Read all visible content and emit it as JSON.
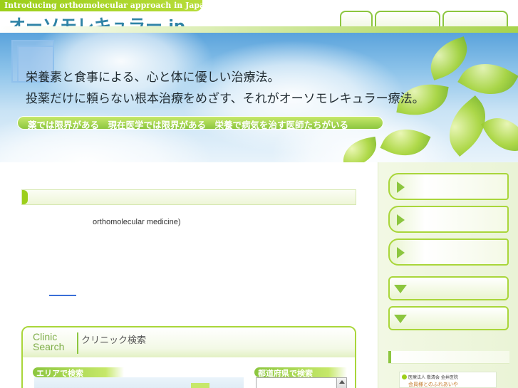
{
  "header": {
    "tagline": "Introducing orthomolecular approach in Japan",
    "logo_main": "オーソモレキュラー",
    "logo_suffix": ".jp"
  },
  "hero": {
    "line1": "栄養素と食事による、心と体に優しい治療法。",
    "line2": "投薬だけに頼らない根本治療をめざす、それがオーソモレキュラー療法。",
    "bar_text": "薬では限界がある　現在医学では限界がある　栄養で病気を治す医師たちがいる"
  },
  "main": {
    "intro_text": "orthomolecular medicine)"
  },
  "clinic_search": {
    "title_en_line1": "Clinic",
    "title_en_line2": "Search",
    "title_jp": "クリニック検索",
    "area_label": "エリアで検索",
    "prefecture_label": "都道府県で検索"
  },
  "sidebar": {
    "banner_line1": "医療法人 敬清会 金井医院",
    "banner_line2": "会員様とのふれあいや"
  },
  "colors": {
    "accent_green": "#8cc63f",
    "logo_blue": "#2f83a6"
  }
}
